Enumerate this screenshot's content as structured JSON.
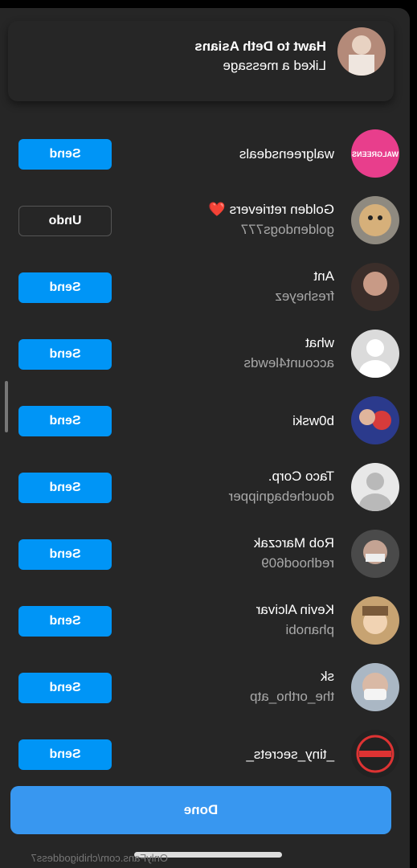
{
  "notification": {
    "title": "Hawt to Deth Asians",
    "subtitle": "Liked a message"
  },
  "people": [
    {
      "name": "walgreensdeals",
      "handle": "",
      "action": "Send",
      "avatar": "walgreens-logo"
    },
    {
      "name": "Golden retrievers ❤️",
      "handle": "goldendogs777",
      "action": "Undo",
      "avatar": "dog-photo"
    },
    {
      "name": "Ant",
      "handle": "fresheyez",
      "action": "Send",
      "avatar": "user-photo"
    },
    {
      "name": "what",
      "handle": "account4lewds",
      "action": "Send",
      "avatar": "default-avatar"
    },
    {
      "name": "b0wski",
      "handle": "",
      "action": "Send",
      "avatar": "user-photo"
    },
    {
      "name": "Taco Corp.",
      "handle": "douchebagnipper",
      "action": "Send",
      "avatar": "default-avatar"
    },
    {
      "name": "Rob Marczak",
      "handle": "redhood609",
      "action": "Send",
      "avatar": "user-photo"
    },
    {
      "name": "Kevin Alcivar",
      "handle": "phanobi",
      "action": "Send",
      "avatar": "anime-avatar"
    },
    {
      "name": "sk",
      "handle": "the_ortho_atp",
      "action": "Send",
      "avatar": "user-photo"
    },
    {
      "name": "_tiny_secrets_",
      "handle": "",
      "action": "Send",
      "avatar": "tiny-secrets-logo"
    }
  ],
  "done_label": "Done",
  "watermark": "OnlyFans.com/chibigoddess7",
  "colors": {
    "sheet": "#262626",
    "send": "#0095f6",
    "done": "#3897f0"
  }
}
